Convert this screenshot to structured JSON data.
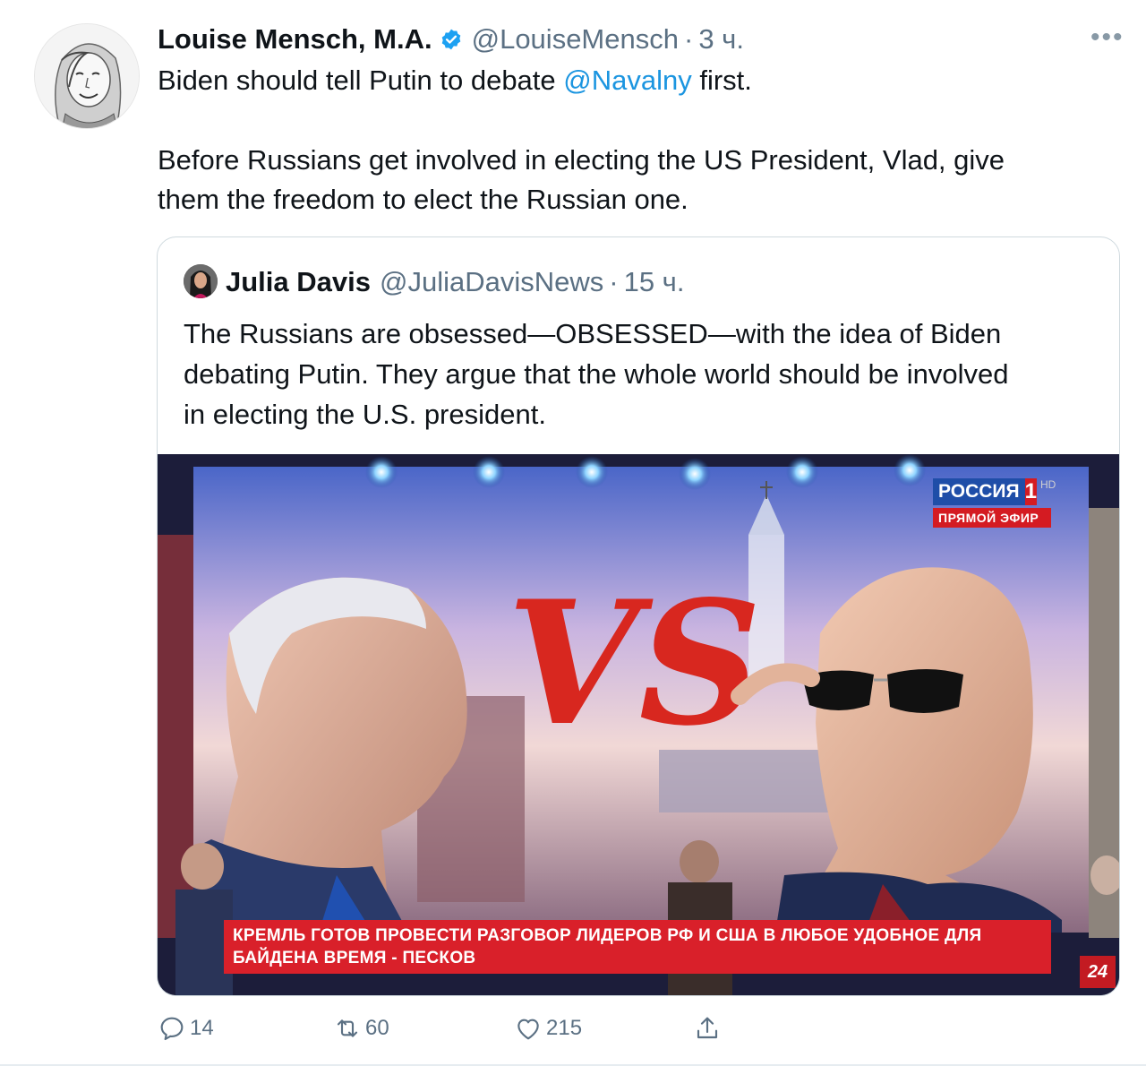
{
  "tweet": {
    "author": {
      "name": "Louise Mensch, M.A.",
      "handle": "@LouiseMensch",
      "verified": true,
      "time": "3 ч.",
      "dot": "·"
    },
    "text": {
      "line1_before": "Biden should tell Putin to debate ",
      "line1_mention": "@Navalny",
      "line1_after": " first.",
      "line2": "Before Russians get involved in electing the US President, Vlad, give",
      "line3": "them the freedom to elect the Russian one."
    },
    "more_icon": "more-horizontal-icon",
    "colors": {
      "accent": "#1b95e0",
      "secondary": "#5b7083",
      "border": "#cfd9de"
    }
  },
  "quote": {
    "author": {
      "name": "Julia Davis",
      "handle": "@JuliaDavisNews",
      "time": "15 ч.",
      "dot": "·"
    },
    "text": {
      "line1": "The Russians are obsessed—OBSESSED—with the idea of Biden",
      "line2": "debating Putin. They argue that the whole world should be involved",
      "line3": "in electing the U.S. president."
    },
    "media": {
      "vs_text": "VS",
      "channel_name": "РОССИЯ",
      "channel_number": "1",
      "channel_hd": "HD",
      "channel_live": "ПРЯМОЙ ЭФИР",
      "ticker_line1": "КРЕМЛЬ ГОТОВ ПРОВЕСТИ РАЗГОВОР ЛИДЕРОВ РФ И США В ЛЮБОЕ УДОБНОЕ ДЛЯ",
      "ticker_line2": "БАЙДЕНА ВРЕМЯ - ПЕСКОВ",
      "corner_badge": "24"
    }
  },
  "actions": {
    "reply": {
      "icon": "reply-icon",
      "count": "14"
    },
    "retweet": {
      "icon": "retweet-icon",
      "count": "60"
    },
    "like": {
      "icon": "like-icon",
      "count": "215"
    },
    "share": {
      "icon": "share-icon"
    }
  }
}
